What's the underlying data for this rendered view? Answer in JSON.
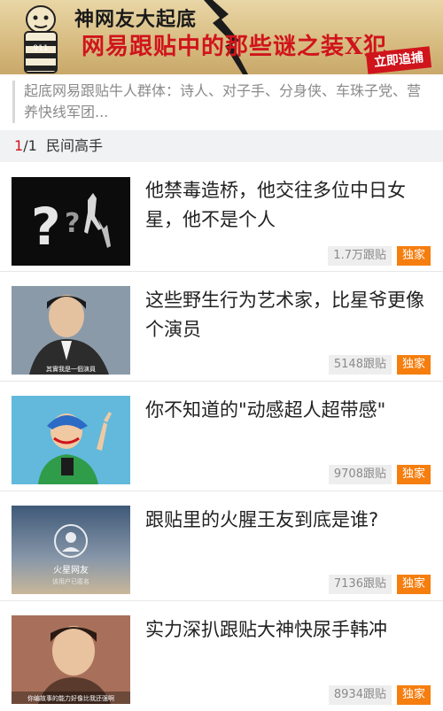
{
  "banner": {
    "title_line1": "神网友大起底",
    "title_line2": "网易跟贴中的那些谜之装X犯",
    "stamp": "立即追捕",
    "mascot_number": "911"
  },
  "description": "起底网易跟贴牛人群体：诗人、对子手、分身侠、车珠子党、营养快线军团...",
  "section": {
    "page_current": "1",
    "page_total": "/1",
    "label": "民间高手"
  },
  "items": [
    {
      "title": "他禁毒造桥，他交往多位中日女星，他不是个人",
      "count": "1.7万跟贴",
      "badge": "独家"
    },
    {
      "title": "这些野生行为艺术家，比星爷更像个演员",
      "count": "5148跟贴",
      "badge": "独家",
      "caption": "其實我是一個演員"
    },
    {
      "title": "你不知道的\"动感超人超带感\"",
      "count": "9708跟贴",
      "badge": "独家"
    },
    {
      "title": "跟贴里的火腥王友到底是谁?",
      "count": "7136跟贴",
      "badge": "独家",
      "thumb_name": "火星网友",
      "thumb_sub": "该用户已匿名"
    },
    {
      "title": "实力深扒跟贴大神快尿手韩冲",
      "count": "8934跟贴",
      "badge": "独家",
      "caption": "你编故事的能力好像比我还强啊"
    }
  ],
  "colors": {
    "accent": "#d0141c",
    "badge": "#f57e0f",
    "banner": "#d8bd82"
  }
}
